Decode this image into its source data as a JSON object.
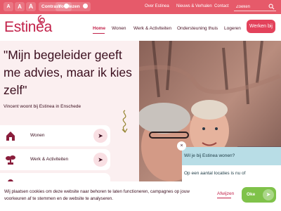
{
  "topbar": {
    "font_small": "A",
    "font_medium": "A",
    "font_large": "A",
    "contrast_label": "Contrast",
    "voorlezen_label": "Voorlezen",
    "links": [
      "Over Estinea",
      "Nieuws & Verhalen",
      "Contact"
    ],
    "search_placeholder": "Zoeken"
  },
  "header": {
    "logo": "Estinea",
    "nav": [
      "Home",
      "Wonen",
      "Werk & Activiteiten",
      "Ondersteuning thuis",
      "Logeren"
    ],
    "cta": "Werken bij"
  },
  "hero": {
    "quote": "\"Mijn begeleider geeft me advies, maar ik kies zelf\"",
    "subtitle": "Vincent woont bij Estinea in Enschede"
  },
  "cards": [
    {
      "label": "Wonen",
      "icon": "house-icon"
    },
    {
      "label": "Werk & Activiteiten",
      "icon": "plant-icon"
    },
    {
      "label": "",
      "icon": "support-icon"
    }
  ],
  "popup": {
    "close": "×",
    "title": "Wil je bij Estinea wonen?",
    "text": "Op een aantal locaties is nu of"
  },
  "cookie": {
    "text": "Wij plaatsen cookies om deze website naar behoren te laten functioneren, campagnes op jouw voorkeuren af te stemmen en de website te analyseren.",
    "decline": "Afwijzen",
    "accept": "Oke"
  },
  "colors": {
    "topbar": "#e65a6a",
    "brand": "#c2224a",
    "accent": "#e3425b",
    "hero_bg": "#fbeff0",
    "accept": "#7fc24a",
    "popup_head": "#b8dde6"
  }
}
